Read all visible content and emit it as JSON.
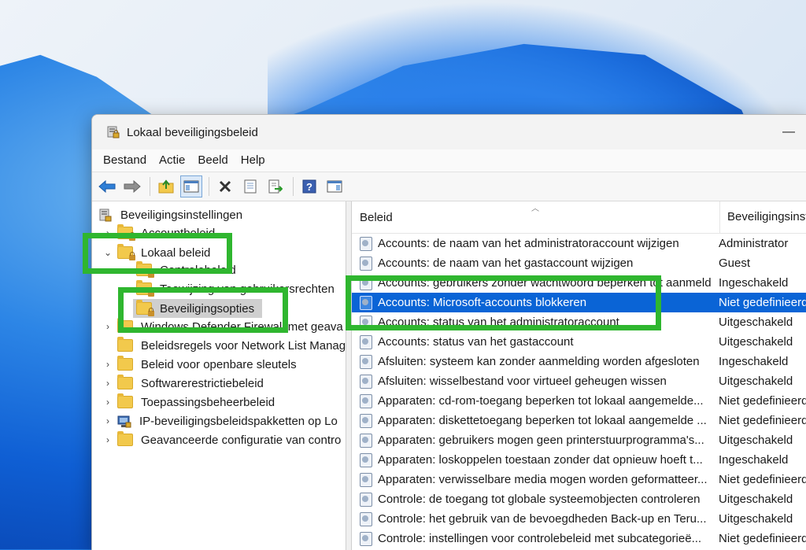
{
  "window": {
    "title": "Lokaal beveiligingsbeleid",
    "minimize": "—"
  },
  "menu": [
    "Bestand",
    "Actie",
    "Beeld",
    "Help"
  ],
  "toolbar": {
    "buttons": [
      "back-arrow-icon",
      "forward-arrow-icon",
      "up-folder-icon",
      "show-hide-tree-icon",
      "delete-icon",
      "properties-icon",
      "export-list-icon",
      "help-icon",
      "action-pane-icon"
    ]
  },
  "tree": {
    "root": "Beveiligingsinstellingen",
    "items": [
      "Accountbeleid",
      "Lokaal beleid",
      "Controlebeleid",
      "Toewijzing van gebruikersrechten",
      "Beveiligingsopties",
      "Windows Defender Firewall met geava",
      "Beleidsregels voor Network List Manag",
      "Beleid voor openbare sleutels",
      "Softwarerestrictiebeleid",
      "Toepassingsbeheerbeleid",
      "IP-beveiligingsbeleidspakketten op Lo",
      "Geavanceerde configuratie van contro"
    ]
  },
  "list": {
    "col_policy": "Beleid",
    "col_setting": "Beveiligingsinstellingen",
    "rows": [
      [
        "Accounts: de naam van het administratoraccount wijzigen",
        "Administrator"
      ],
      [
        "Accounts: de naam van het gastaccount wijzigen",
        "Guest"
      ],
      [
        "Accounts: gebruikers zonder wachtwoord beperken tot aanmelden tot aa...",
        "Ingeschakeld"
      ],
      [
        "Accounts: Microsoft-accounts blokkeren",
        "Niet gedefinieerd"
      ],
      [
        "Accounts: status van het administratoraccount",
        "Uitgeschakeld"
      ],
      [
        "Accounts: status van het gastaccount",
        "Uitgeschakeld"
      ],
      [
        "Afsluiten: systeem kan zonder aanmelding worden afgesloten",
        "Ingeschakeld"
      ],
      [
        "Afsluiten: wisselbestand voor virtueel geheugen wissen",
        "Uitgeschakeld"
      ],
      [
        "Apparaten: cd-rom-toegang beperken tot lokaal aangemelde...",
        "Niet gedefinieerd"
      ],
      [
        "Apparaten: diskettetoegang beperken tot lokaal aangemelde ...",
        "Niet gedefinieerd"
      ],
      [
        "Apparaten: gebruikers mogen geen printerstuurprogramma's...",
        "Uitgeschakeld"
      ],
      [
        "Apparaten: loskoppelen toestaan zonder dat opnieuw hoeft t...",
        "Ingeschakeld"
      ],
      [
        "Apparaten: verwisselbare media mogen worden geformatteer...",
        "Niet gedefinieerd"
      ],
      [
        "Controle: de toegang tot globale systeemobjecten controleren",
        "Uitgeschakeld"
      ],
      [
        "Controle: het gebruik van de bevoegdheden Back-up en Teru...",
        "Uitgeschakeld"
      ],
      [
        "Controle: instellingen voor controlebeleid met subcategorieë...",
        "Niet gedefinieerd"
      ]
    ]
  },
  "colors": {
    "highlight": "#2fb62f",
    "selection": "#0a64d6"
  }
}
